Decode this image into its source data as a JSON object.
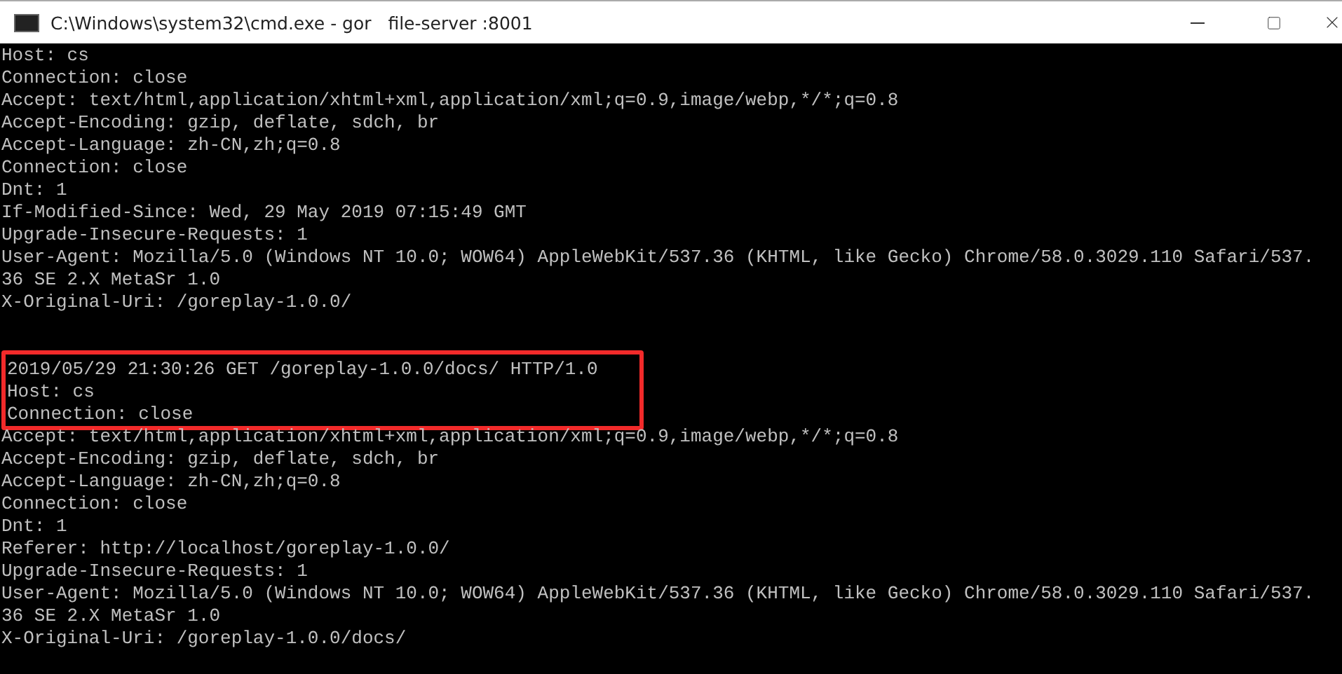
{
  "window": {
    "title": "C:\\Windows\\system32\\cmd.exe - gor   file-server :8001"
  },
  "terminal": {
    "blocks": [
      {
        "lines": [
          {
            "text": "Host: cs",
            "highlighted": false
          },
          {
            "text": "Connection: close",
            "highlighted": false
          },
          {
            "text": "Accept: text/html,application/xhtml+xml,application/xml;q=0.9,image/webp,*/*;q=0.8",
            "highlighted": false
          },
          {
            "text": "Accept-Encoding: gzip, deflate, sdch, br",
            "highlighted": false
          },
          {
            "text": "Accept-Language: zh-CN,zh;q=0.8",
            "highlighted": false
          },
          {
            "text": "Connection: close",
            "highlighted": false
          },
          {
            "text": "Dnt: 1",
            "highlighted": false
          },
          {
            "text": "If-Modified-Since: Wed, 29 May 2019 07:15:49 GMT",
            "highlighted": false
          },
          {
            "text": "Upgrade-Insecure-Requests: 1",
            "highlighted": false
          },
          {
            "text": "User-Agent: Mozilla/5.0 (Windows NT 10.0; WOW64) AppleWebKit/537.36 (KHTML, like Gecko) Chrome/58.0.3029.110 Safari/537.",
            "highlighted": false
          },
          {
            "text": "36 SE 2.X MetaSr 1.0",
            "highlighted": false
          },
          {
            "text": "X-Original-Uri: /goreplay-1.0.0/",
            "highlighted": false
          }
        ]
      },
      {
        "lines": [
          {
            "text": "2019/05/29 21:30:26 GET /goreplay-1.0.0/docs/ HTTP/1.0",
            "highlighted": true
          },
          {
            "text": "Host: cs",
            "highlighted": true
          },
          {
            "text": "Connection: close",
            "highlighted": true
          },
          {
            "text": "Accept: text/html,application/xhtml+xml,application/xml;q=0.9,image/webp,*/*;q=0.8",
            "highlighted": false
          },
          {
            "text": "Accept-Encoding: gzip, deflate, sdch, br",
            "highlighted": false
          },
          {
            "text": "Accept-Language: zh-CN,zh;q=0.8",
            "highlighted": false
          },
          {
            "text": "Connection: close",
            "highlighted": false
          },
          {
            "text": "Dnt: 1",
            "highlighted": false
          },
          {
            "text": "Referer: http://localhost/goreplay-1.0.0/",
            "highlighted": false
          },
          {
            "text": "Upgrade-Insecure-Requests: 1",
            "highlighted": false
          },
          {
            "text": "User-Agent: Mozilla/5.0 (Windows NT 10.0; WOW64) AppleWebKit/537.36 (KHTML, like Gecko) Chrome/58.0.3029.110 Safari/537.",
            "highlighted": false
          },
          {
            "text": "36 SE 2.X MetaSr 1.0",
            "highlighted": false
          },
          {
            "text": "X-Original-Uri: /goreplay-1.0.0/docs/",
            "highlighted": false
          }
        ]
      }
    ]
  }
}
